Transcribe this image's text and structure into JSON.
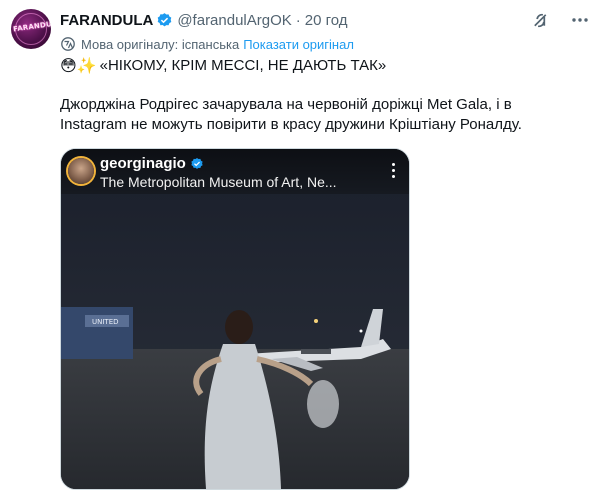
{
  "tweet": {
    "display_name": "FARANDULA",
    "handle": "@farandulArgOK",
    "separator": "·",
    "time": "20 год",
    "avatar_text": "FARANDULA",
    "translation_note": "Мова оригіналу: іспанська",
    "show_original": "Показати оригінал",
    "emojis": "😳✨",
    "line1": "«НІКОМУ, КРІМ МЕССІ, НЕ ДАЮТЬ ТАК»",
    "line2": "Джорджіна Родрігес зачарувала на червоній доріжці Met Gala, і в Instagram не можуть повірити в красу дружини Кріштіану Роналду.",
    "verified_color": "#1d9bf0"
  },
  "icons": {
    "grok": "grok-icon",
    "more": "more-icon",
    "translate": "globe-translate-icon"
  },
  "media": {
    "ig_username": "georginagio",
    "ig_location": "The Metropolitan Museum of Art, Ne...",
    "plane_label": "UNITED"
  }
}
